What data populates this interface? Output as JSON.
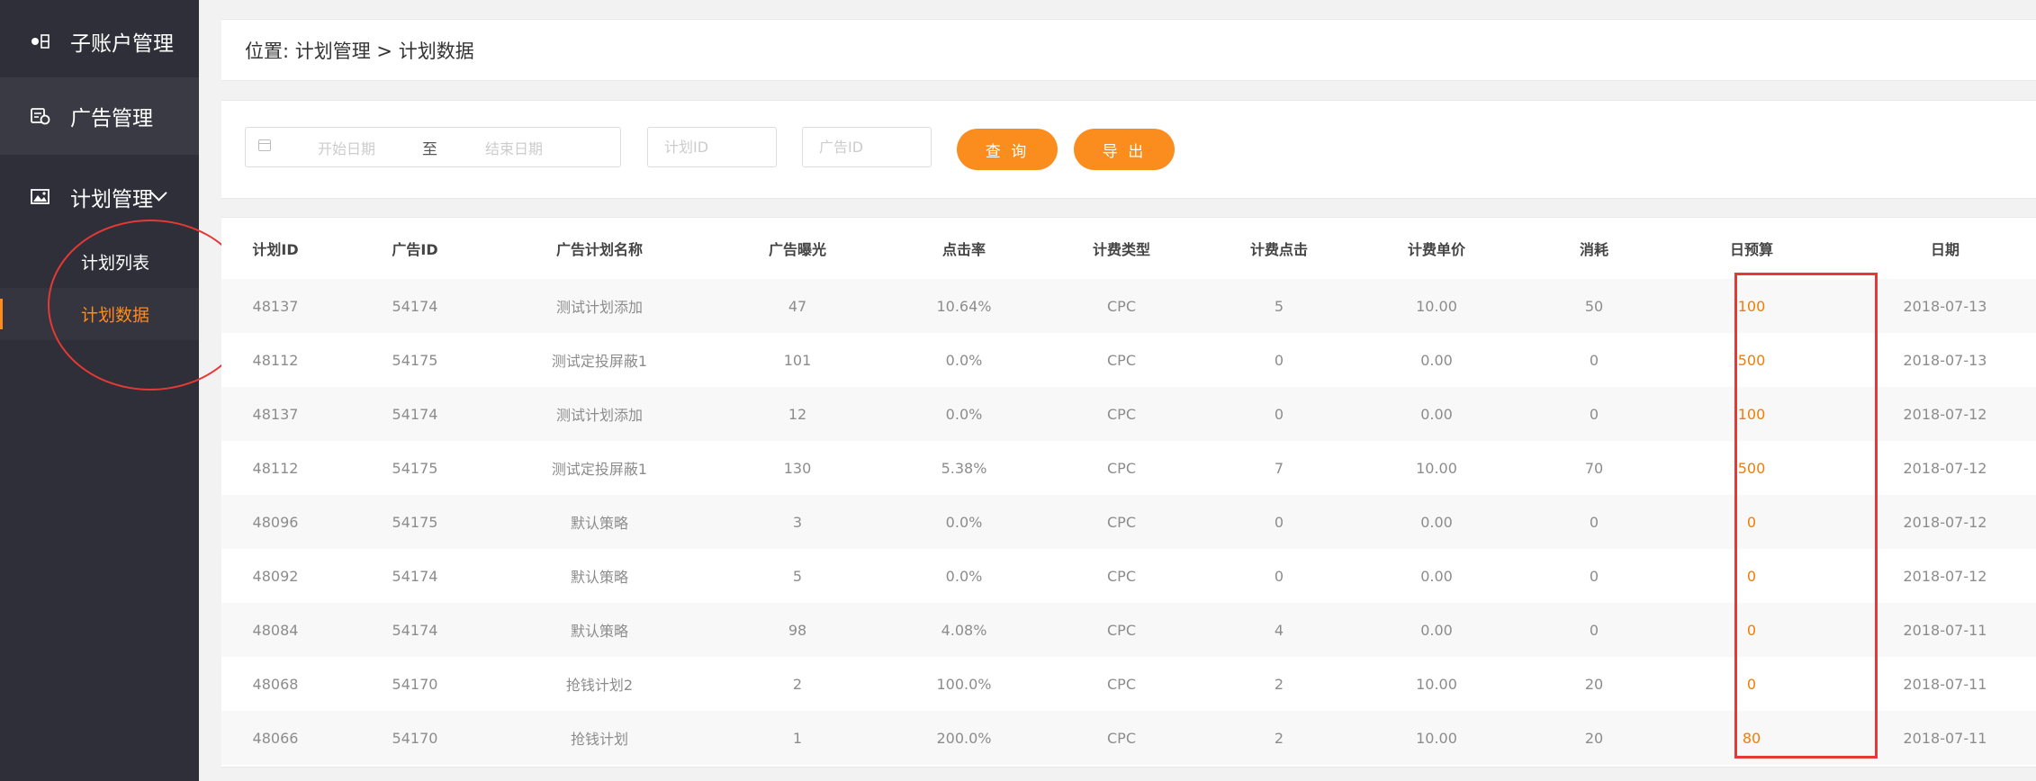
{
  "sidebar": {
    "items": [
      {
        "label": "子账户管理",
        "icon": "sub-account-icon"
      },
      {
        "label": "广告管理",
        "icon": "ad-management-icon"
      },
      {
        "label": "计划管理",
        "icon": "image-icon"
      }
    ],
    "sub_items": [
      {
        "label": "计划列表"
      },
      {
        "label": "计划数据"
      }
    ]
  },
  "breadcrumb": "位置: 计划管理 > 计划数据",
  "filters": {
    "start_placeholder": "开始日期",
    "separator": "至",
    "end_placeholder": "结束日期",
    "plan_id_placeholder": "计划ID",
    "ad_id_placeholder": "广告ID",
    "query_label": "查 询",
    "export_label": "导 出"
  },
  "table": {
    "headers": [
      "计划ID",
      "广告ID",
      "广告计划名称",
      "广告曝光",
      "点击率",
      "计费类型",
      "计费点击",
      "计费单价",
      "消耗",
      "日预算",
      "日期"
    ],
    "rows": [
      [
        "48137",
        "54174",
        "测试计划添加",
        "47",
        "10.64%",
        "CPC",
        "5",
        "10.00",
        "50",
        "100",
        "2018-07-13"
      ],
      [
        "48112",
        "54175",
        "测试定投屏蔽1",
        "101",
        "0.0%",
        "CPC",
        "0",
        "0.00",
        "0",
        "500",
        "2018-07-13"
      ],
      [
        "48137",
        "54174",
        "测试计划添加",
        "12",
        "0.0%",
        "CPC",
        "0",
        "0.00",
        "0",
        "100",
        "2018-07-12"
      ],
      [
        "48112",
        "54175",
        "测试定投屏蔽1",
        "130",
        "5.38%",
        "CPC",
        "7",
        "10.00",
        "70",
        "500",
        "2018-07-12"
      ],
      [
        "48096",
        "54175",
        "默认策略",
        "3",
        "0.0%",
        "CPC",
        "0",
        "0.00",
        "0",
        "0",
        "2018-07-12"
      ],
      [
        "48092",
        "54174",
        "默认策略",
        "5",
        "0.0%",
        "CPC",
        "0",
        "0.00",
        "0",
        "0",
        "2018-07-12"
      ],
      [
        "48084",
        "54174",
        "默认策略",
        "98",
        "4.08%",
        "CPC",
        "4",
        "0.00",
        "0",
        "0",
        "2018-07-11"
      ],
      [
        "48068",
        "54170",
        "抢钱计划2",
        "2",
        "100.0%",
        "CPC",
        "2",
        "10.00",
        "20",
        "0",
        "2018-07-11"
      ],
      [
        "48066",
        "54170",
        "抢钱计划",
        "1",
        "200.0%",
        "CPC",
        "2",
        "10.00",
        "20",
        "80",
        "2018-07-11"
      ]
    ]
  },
  "colors": {
    "sidebar_bg": "#2e2f38",
    "accent": "#fb8c1e",
    "annotation": "#e53935"
  }
}
